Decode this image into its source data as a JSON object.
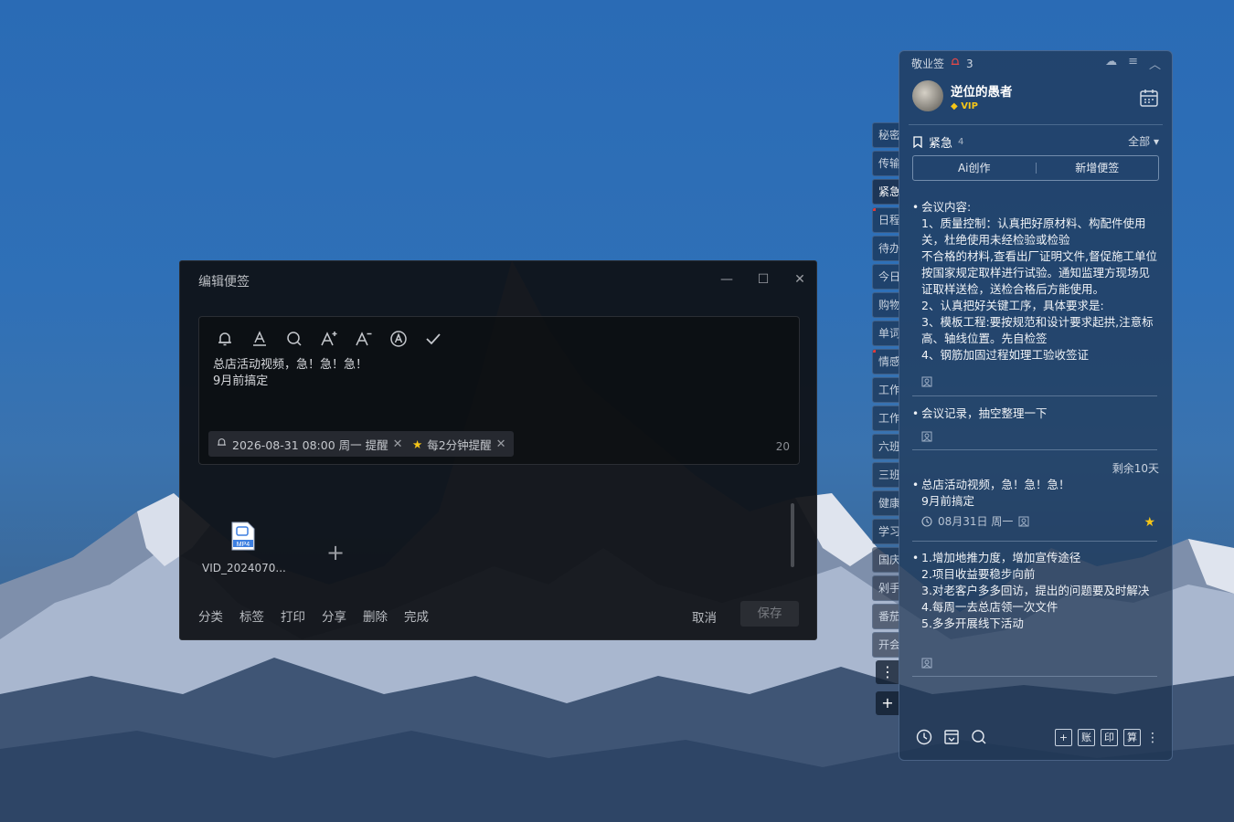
{
  "editor": {
    "title": "编辑便签",
    "minimize": "—",
    "maximize": "☐",
    "close": "✕",
    "toolbar": [
      "bell-icon",
      "font-color-icon",
      "search-icon",
      "font-increase-icon",
      "font-decrease-icon",
      "font-style-icon",
      "check-icon"
    ],
    "content": "总店活动视频，急！急！急！\n9月前搞定",
    "reminder_chip": "2026-08-31 08:00 周一 提醒",
    "repeat_chip": "每2分钟提醒",
    "char_count": "20",
    "attachment": {
      "type": "MP4",
      "name": "VID_2024070..."
    },
    "add_attachment": "+",
    "footer": [
      "分类",
      "标签",
      "打印",
      "分享",
      "删除",
      "完成"
    ],
    "cancel": "取消",
    "save": "保存"
  },
  "sidetabs": [
    {
      "label": "秘密",
      "marker": false
    },
    {
      "label": "传输",
      "marker": false
    },
    {
      "label": "紧急",
      "marker": false,
      "active": true
    },
    {
      "label": "日程",
      "marker": true
    },
    {
      "label": "待办",
      "marker": false
    },
    {
      "label": "今日",
      "marker": false
    },
    {
      "label": "购物",
      "marker": false
    },
    {
      "label": "单词",
      "marker": false
    },
    {
      "label": "情感",
      "marker": true
    },
    {
      "label": "工作",
      "marker": false
    },
    {
      "label": "工作",
      "marker": false
    },
    {
      "label": "六班",
      "marker": false
    },
    {
      "label": "三班",
      "marker": false
    },
    {
      "label": "健康",
      "marker": false
    },
    {
      "label": "学习",
      "marker": false
    },
    {
      "label": "国庆",
      "marker": false
    },
    {
      "label": "剁手",
      "marker": false
    },
    {
      "label": "番茄",
      "marker": false
    },
    {
      "label": "开会",
      "marker": false
    }
  ],
  "sidetab_more": "⋮",
  "sidetab_add": "+",
  "panel": {
    "app_name": "敬业签",
    "notification_count": "3",
    "username": "逆位的愚者",
    "vip": "VIP",
    "category": "紧急",
    "category_count": "4",
    "filter": "全部 ▾",
    "ai_button": "Ai创作",
    "new_button": "新增便签",
    "notes": [
      {
        "text": "会议内容:\n1、质量控制：认真把好原材料、构配件使用关，杜绝使用未经检验或检验\n不合格的材料,查看出厂证明文件,督促施工单位按国家规定取样进行试验。通知监理方现场见证取样送检，送检合格后方能使用。\n2、认真把好关键工序，具体要求是:\n3、模板工程:要按规范和设计要求起拱,注意标高、轴线位置。先自检签\n4、钢筋加固过程如理工验收签证"
      },
      {
        "text": "会议记录，抽空整理一下"
      },
      {
        "remaining": "剩余10天",
        "text": "总店活动视频，急！急！急！\n9月前搞定",
        "date": "08月31日 周一"
      },
      {
        "text": "1.增加地推力度，增加宣传途径\n2.项目收益要稳步向前\n3.对老客户多多回访，提出的问题要及时解决\n4.每周一去总店领一次文件\n5.多多开展线下活动"
      }
    ],
    "bottom_icons": [
      "账",
      "印",
      "算"
    ]
  }
}
